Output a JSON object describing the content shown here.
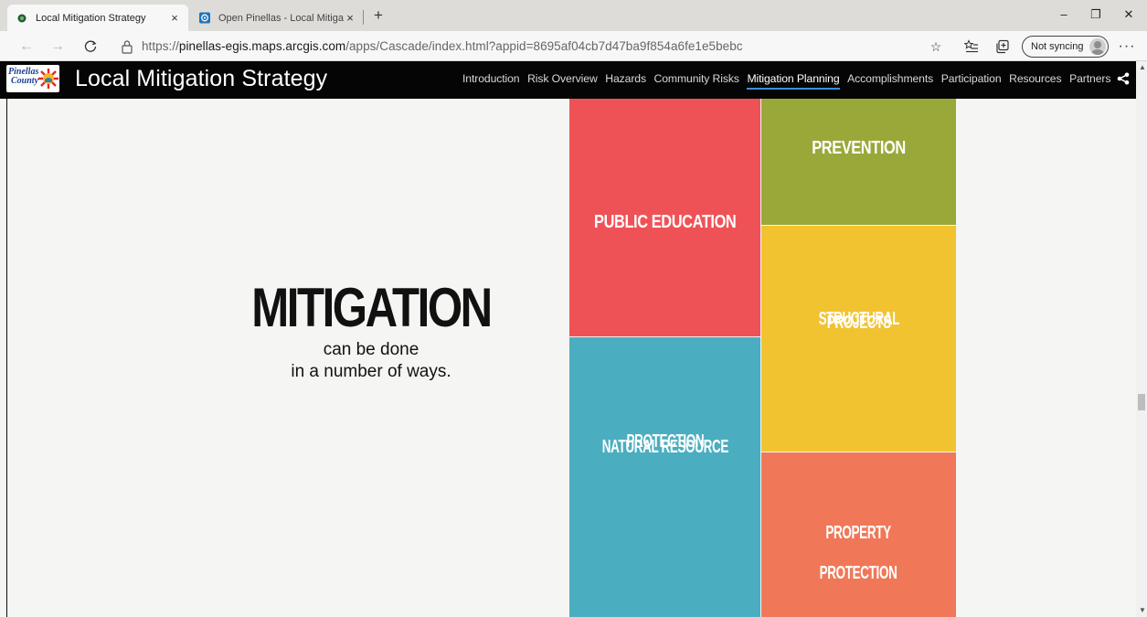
{
  "browser": {
    "tabs": [
      {
        "title": "Local Mitigation Strategy",
        "active": true
      },
      {
        "title": "Open Pinellas - Local Mitigation",
        "active": false
      }
    ],
    "new_tab_symbol": "+",
    "close_symbol": "×",
    "url_prefix": "https://",
    "url_host": "pinellas-egis.maps.arcgis.com",
    "url_path": "/apps/Cascade/index.html?appid=8695af04cb7d47ba9f854a6fe1e5bebc",
    "sync_label": "Not syncing",
    "window_controls": {
      "minimize": "–",
      "restore": "❐",
      "close": "✕"
    }
  },
  "site": {
    "logo_text": [
      "Pinellas",
      "County"
    ],
    "title": "Local Mitigation Strategy",
    "nav": [
      {
        "label": "Introduction",
        "active": false
      },
      {
        "label": "Risk Overview",
        "active": false
      },
      {
        "label": "Hazards",
        "active": false
      },
      {
        "label": "Community Risks",
        "active": false
      },
      {
        "label": "Mitigation Planning",
        "active": true
      },
      {
        "label": "Accomplishments",
        "active": false
      },
      {
        "label": "Participation",
        "active": false
      },
      {
        "label": "Resources",
        "active": false
      },
      {
        "label": "Partners",
        "active": false
      }
    ]
  },
  "content": {
    "headline": "MITIGATION",
    "subline_1": "can be done",
    "subline_2": "in a number of ways."
  },
  "tiles": {
    "public_education": "PUBLIC EDUCATION",
    "prevention": "PREVENTION",
    "structural_projects": [
      "STRUCTURAL",
      "PROJECTS"
    ],
    "natural_resource_protection": [
      "NATURAL RESOURCE",
      "PROTECTION"
    ],
    "property_protection": [
      "PROPERTY",
      "PROTECTION"
    ]
  },
  "colors": {
    "public_education": "#ef5256",
    "prevention": "#9aa83a",
    "structural_projects": "#f1c330",
    "natural_resource_protection": "#4aaec0",
    "property_protection": "#f07858",
    "header_bg": "#050505",
    "nav_active_underline": "#3d8fd6"
  },
  "icons": [
    "back-icon",
    "forward-icon",
    "refresh-icon",
    "lock-icon",
    "favorite-star-icon",
    "favorites-list-icon",
    "collections-icon",
    "profile-avatar-icon",
    "more-icon",
    "share-icon"
  ]
}
